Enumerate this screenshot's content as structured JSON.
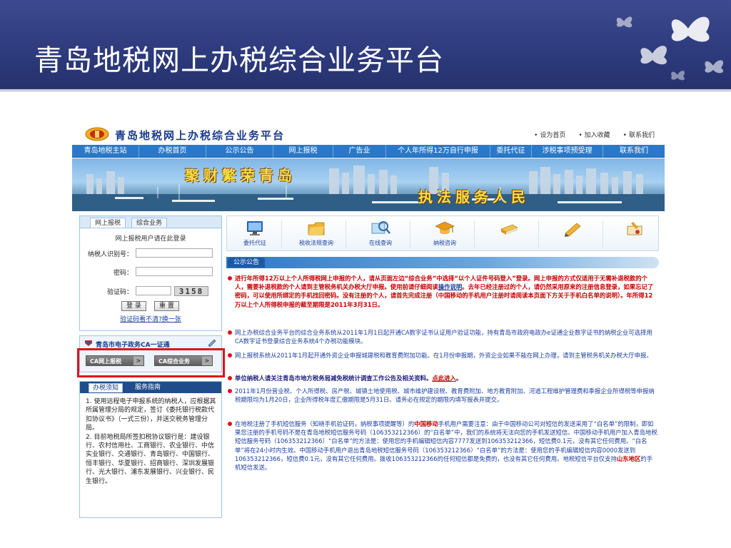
{
  "slide": {
    "title": "青岛地税网上办税综合业务平台"
  },
  "site": {
    "logo_text": "青岛地税网上办税综合业务平台",
    "top_links": [
      "设为首页",
      "加入收藏",
      "联系我们"
    ],
    "nav": [
      "青岛地税主站",
      "办税首页",
      "公示公告",
      "网上报税",
      "广告业",
      "个人年所得12万自行申报",
      "委托代征",
      "涉税事项预受理",
      "联系我们"
    ],
    "banner": {
      "slogan1": "聚财繁荣青岛",
      "slogan2": "执法服务人民"
    }
  },
  "login": {
    "tabs": [
      "网上报税",
      "综合业务"
    ],
    "hint": "网上报税用户请在此登录",
    "taxpayer_label": "纳税人识别号：",
    "password_label": "密码：",
    "captcha_label": "验证码：",
    "captcha_value": "3158",
    "submit_label": "登 录",
    "reset_label": "重 置",
    "captcha_link": "验证码看不清?换一张"
  },
  "ca": {
    "title": "青岛市电子政务CA一证通",
    "btn_report": "CA网上报税",
    "btn_general": "CA综合业务",
    "arrow": ">"
  },
  "guide": {
    "tabs": [
      "办税须知",
      "服务指南"
    ],
    "text": "1. 使用远程电子申报系统的纳税人，应根据其所属管理分局的规定，签订《委托银行税款代扣协议书》（一式三份），并送交税务管理分局。\n2. 目前地税局所签扣税协议银行是：建设银行、农村信用社、工商银行、农业银行、中信实业银行、交通银行、青岛银行、中国银行、恒丰银行、华夏银行、招商银行、深圳发展银行、光大银行、浦东发展银行、兴业银行、民生银行。"
  },
  "icons": [
    {
      "label": "委托代征",
      "icon": "monitor-icon"
    },
    {
      "label": "税收法规查询",
      "icon": "folder-icon"
    },
    {
      "label": "在线查询",
      "icon": "magnifier-icon"
    },
    {
      "label": "纳税咨询",
      "icon": "graduation-cap-icon"
    },
    {
      "label": "",
      "icon": "books-icon"
    },
    {
      "label": "",
      "icon": "pencil-icon"
    },
    {
      "label": "",
      "icon": "certificate-icon"
    }
  ],
  "notice": {
    "tab": "公示公告",
    "items": [
      {
        "style": "red",
        "text": "进行年所得12万以上个人所得税网上申报的个人，请从页面左边“综合业务”中选择“以个人证件号码登入”登录。网上申报的方式仅适用于无需补退税款的个人，需要补退税款的个人请到主管税务机关办税大厅申报。使用前请仔细阅读",
        "link": "操作说明",
        "text2": "。去年已经注册过的个人，请仍然采用原来的注册信息登录，如果忘记了密码，可以使用所绑定的手机找回密码。没有注册的个人，请首先完成注册（中国移动的手机用户注册时请阅读本页面下方关于手机白名单的说明）。年所得12万以上个人所得税申报的截至期限是2011年3月31日。"
      },
      {
        "style": "blue",
        "text": "网上办税综合业务平台的综合业务系统从2011年1月1日起开通CA数字证书认证用户验证功能，持有青岛市政府电政办e证通企业数字证书的纳税企业可选择用CA数字证书登录综合业务系统4个办税功能模块。"
      },
      {
        "style": "blue",
        "text": "网上报税系统从2011年1月起开通外资企业申报城建税和教育费附加功能。在1月份申报期，外资企业如果不能在网上办理，请到主管税务机关办税大厅申报。"
      },
      {
        "style": "dark",
        "text": "单位纳税人请关注青岛市地方税务局减免税统计调查工作公告及相关资料。",
        "link": "点此进入",
        "text2": "。"
      },
      {
        "style": "blue",
        "text": "2011年1月份营业税、个人所得税、房产税、城镇土地使用税、城市维护建设税、教育费附加、地方教育附加、河道工程维护管理费和季报企业所得税等申报纳税期限均为1月20日，企业所得税年度汇缴期限是5月31日。请务必在规定的期限内填写报表并提交。"
      },
      {
        "style": "blue",
        "text": "在地税注册了手机短信服务（知晓手机验证码，纳税事项提醒等）的",
        "bold": "中国移动",
        "text2": "手机用户需要注意：由于中国移动公司对短信的发送采用了“白名单”的限制，即如果您注册的手机号码不是在青岛地税短信服务号码（106353212366）的“白名单”中，我们的系统将无法向您的手机发送短信。中国移动手机用户加入青岛地税短信服务号码（106353212366）“白名单”的方法是：使用您的手机编辑短信内容7777发送到106353212366，短信费0.1元，没有其它任何费用。“白名单”将在24小时内生效。中国移动手机用户退出青岛地税短信服务号码（106353212366）“白名单”的方法是：使用您的手机编辑短信内容0000发送到106353212366，短信费0.1元，没有其它任何费用。拨收106353212366的任何短信都是免费的，也没有其它任何费用。地税短信平台仅支持",
        "bold2": "山东地区",
        "text3": "的手机短信发送。"
      }
    ]
  }
}
